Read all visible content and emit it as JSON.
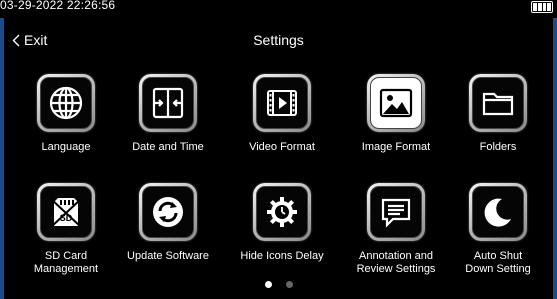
{
  "status": {
    "timestamp": "03-29-2022 22:26:56"
  },
  "header": {
    "exit_label": "Exit",
    "title": "Settings"
  },
  "tiles": [
    {
      "label": "Language",
      "icon": "globe-icon"
    },
    {
      "label": "Date and Time",
      "icon": "date-time-icon"
    },
    {
      "label": "Video Format",
      "icon": "film-icon"
    },
    {
      "label": "Image Format",
      "icon": "image-icon"
    },
    {
      "label": "Folders",
      "icon": "folder-icon"
    },
    {
      "label": "SD Card Management",
      "icon": "sd-card-icon"
    },
    {
      "label": "Update Software",
      "icon": "refresh-icon"
    },
    {
      "label": "Hide Icons Delay",
      "icon": "gear-clock-icon"
    },
    {
      "label": "Annotation and Review Settings",
      "icon": "comment-icon"
    },
    {
      "label": "Auto Shut Down Setting",
      "icon": "moon-icon"
    }
  ],
  "pagination": {
    "pages": 2,
    "current": 1
  }
}
